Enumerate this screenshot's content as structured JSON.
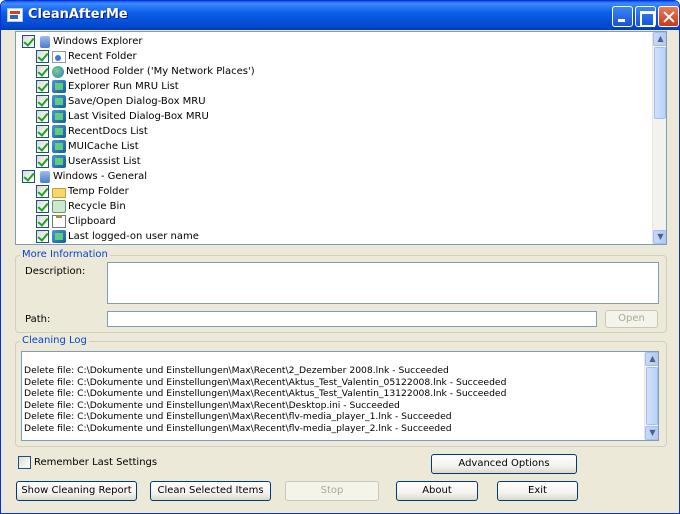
{
  "window": {
    "title": "CleanAfterMe"
  },
  "tree": {
    "items": [
      {
        "label": "Windows Explorer",
        "level": 0,
        "checked": true,
        "icon": "computer-icon"
      },
      {
        "label": "Recent Folder",
        "level": 1,
        "checked": true,
        "icon": "folder-document-icon"
      },
      {
        "label": "NetHood Folder ('My Network Places')",
        "level": 1,
        "checked": true,
        "icon": "network-icon"
      },
      {
        "label": "Explorer Run MRU List",
        "level": 1,
        "checked": true,
        "icon": "registry-icon"
      },
      {
        "label": "Save/Open Dialog-Box MRU",
        "level": 1,
        "checked": true,
        "icon": "registry-icon"
      },
      {
        "label": "Last Visited  Dialog-Box MRU",
        "level": 1,
        "checked": true,
        "icon": "registry-icon"
      },
      {
        "label": "RecentDocs List",
        "level": 1,
        "checked": true,
        "icon": "registry-icon"
      },
      {
        "label": "MUICache List",
        "level": 1,
        "checked": true,
        "icon": "registry-icon"
      },
      {
        "label": "UserAssist List",
        "level": 1,
        "checked": true,
        "icon": "registry-icon"
      },
      {
        "label": "Windows - General",
        "level": 0,
        "checked": true,
        "icon": "computer-icon"
      },
      {
        "label": "Temp Folder",
        "level": 1,
        "checked": true,
        "icon": "folder-icon"
      },
      {
        "label": "Recycle Bin",
        "level": 1,
        "checked": true,
        "icon": "recycle-bin-icon"
      },
      {
        "label": "Clipboard",
        "level": 1,
        "checked": true,
        "icon": "clipboard-icon"
      },
      {
        "label": "Last logged-on user name",
        "level": 1,
        "checked": true,
        "icon": "registry-icon"
      }
    ]
  },
  "more_info": {
    "legend": "More Information",
    "description_label": "Description:",
    "path_label": "Path:",
    "open_label": "Open"
  },
  "cleaning_log": {
    "legend": "Cleaning Log",
    "lines": [
      "Delete file: C:\\Dokumente und Einstellungen\\Max\\Recent\\2_Dezember 2008.lnk  -  Succeeded",
      "Delete file: C:\\Dokumente und Einstellungen\\Max\\Recent\\Aktus_Test_Valentin_05122008.lnk  -  Succeeded",
      "Delete file: C:\\Dokumente und Einstellungen\\Max\\Recent\\Aktus_Test_Valentin_13122008.lnk  -  Succeeded",
      "Delete file: C:\\Dokumente und Einstellungen\\Max\\Recent\\Desktop.ini  -  Succeeded",
      "Delete file: C:\\Dokumente und Einstellungen\\Max\\Recent\\flv-media_player_1.lnk  -  Succeeded",
      "Delete file: C:\\Dokumente und Einstellungen\\Max\\Recent\\flv-media_player_2.lnk  -  Succeeded"
    ]
  },
  "options": {
    "remember_label": "Remember Last Settings",
    "remember_checked": false,
    "advanced_label": "Advanced Options"
  },
  "buttons": {
    "show_report": "Show Cleaning Report",
    "clean_selected": "Clean Selected Items",
    "stop": "Stop",
    "about": "About",
    "exit": "Exit"
  },
  "colors": {
    "titlebar": "#0b5fe8",
    "group_legend": "#0046d5",
    "window_bg": "#ece9d8",
    "check": "#21a121"
  }
}
